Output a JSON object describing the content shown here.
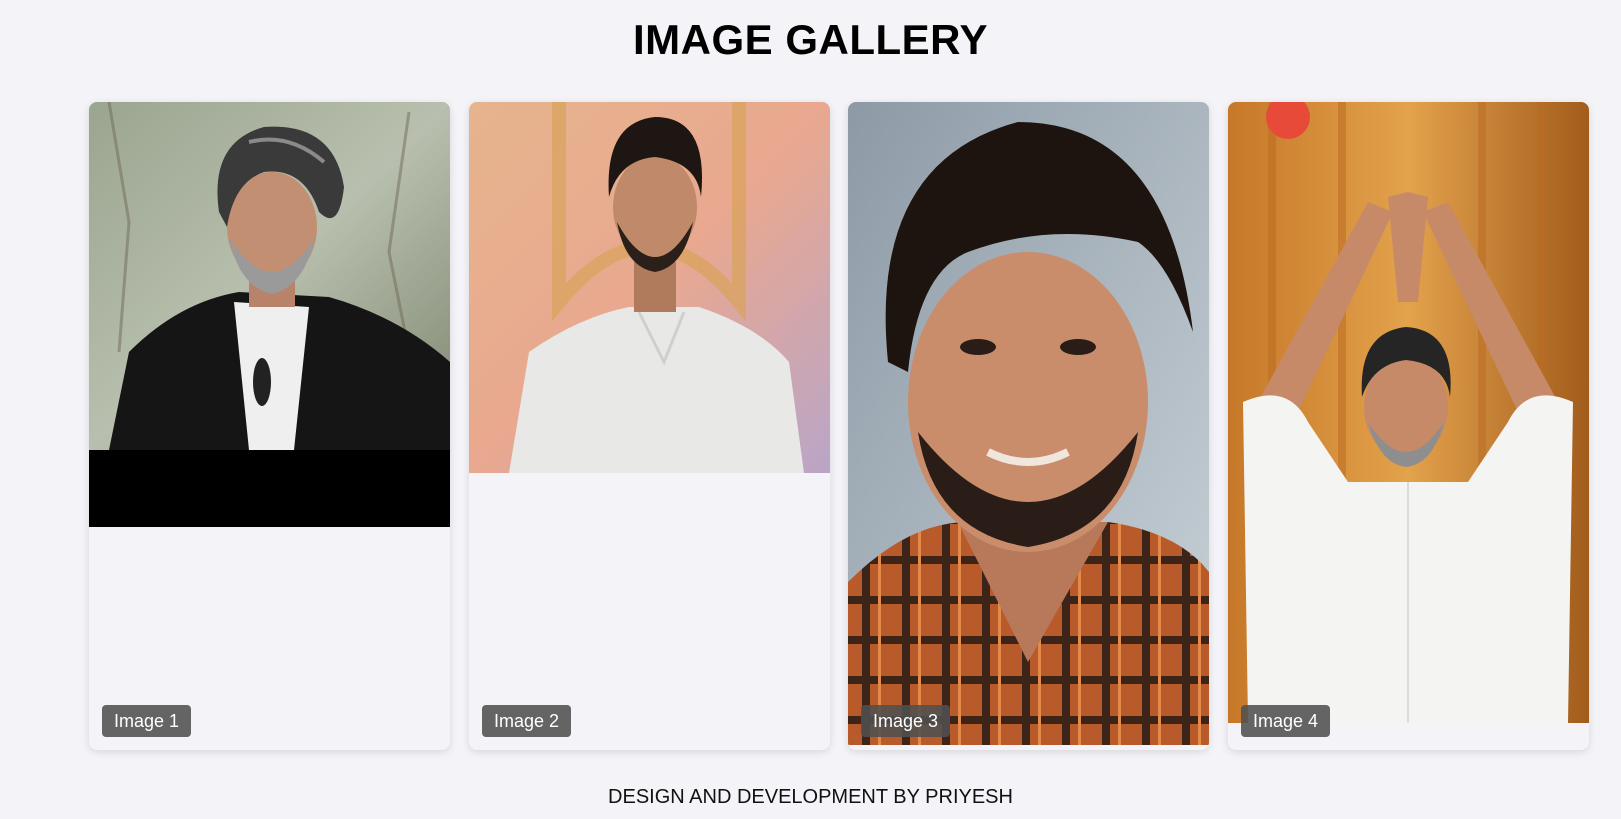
{
  "page": {
    "title": "IMAGE GALLERY",
    "footer": "DESIGN AND DEVELOPMENT BY PRIYESH"
  },
  "gallery": {
    "items": [
      {
        "caption": "Image 1",
        "photo": "portrait-grey-hair-black-jacket"
      },
      {
        "caption": "Image 2",
        "photo": "portrait-white-linen-shirt"
      },
      {
        "caption": "Image 3",
        "photo": "closeup-smiling-checked-shirt"
      },
      {
        "caption": "Image 4",
        "photo": "white-shirt-folded-hands-greeting"
      }
    ]
  },
  "colors": {
    "background": "#f4f4f8",
    "caption_bg": "#505050",
    "caption_text": "#ffffff"
  }
}
